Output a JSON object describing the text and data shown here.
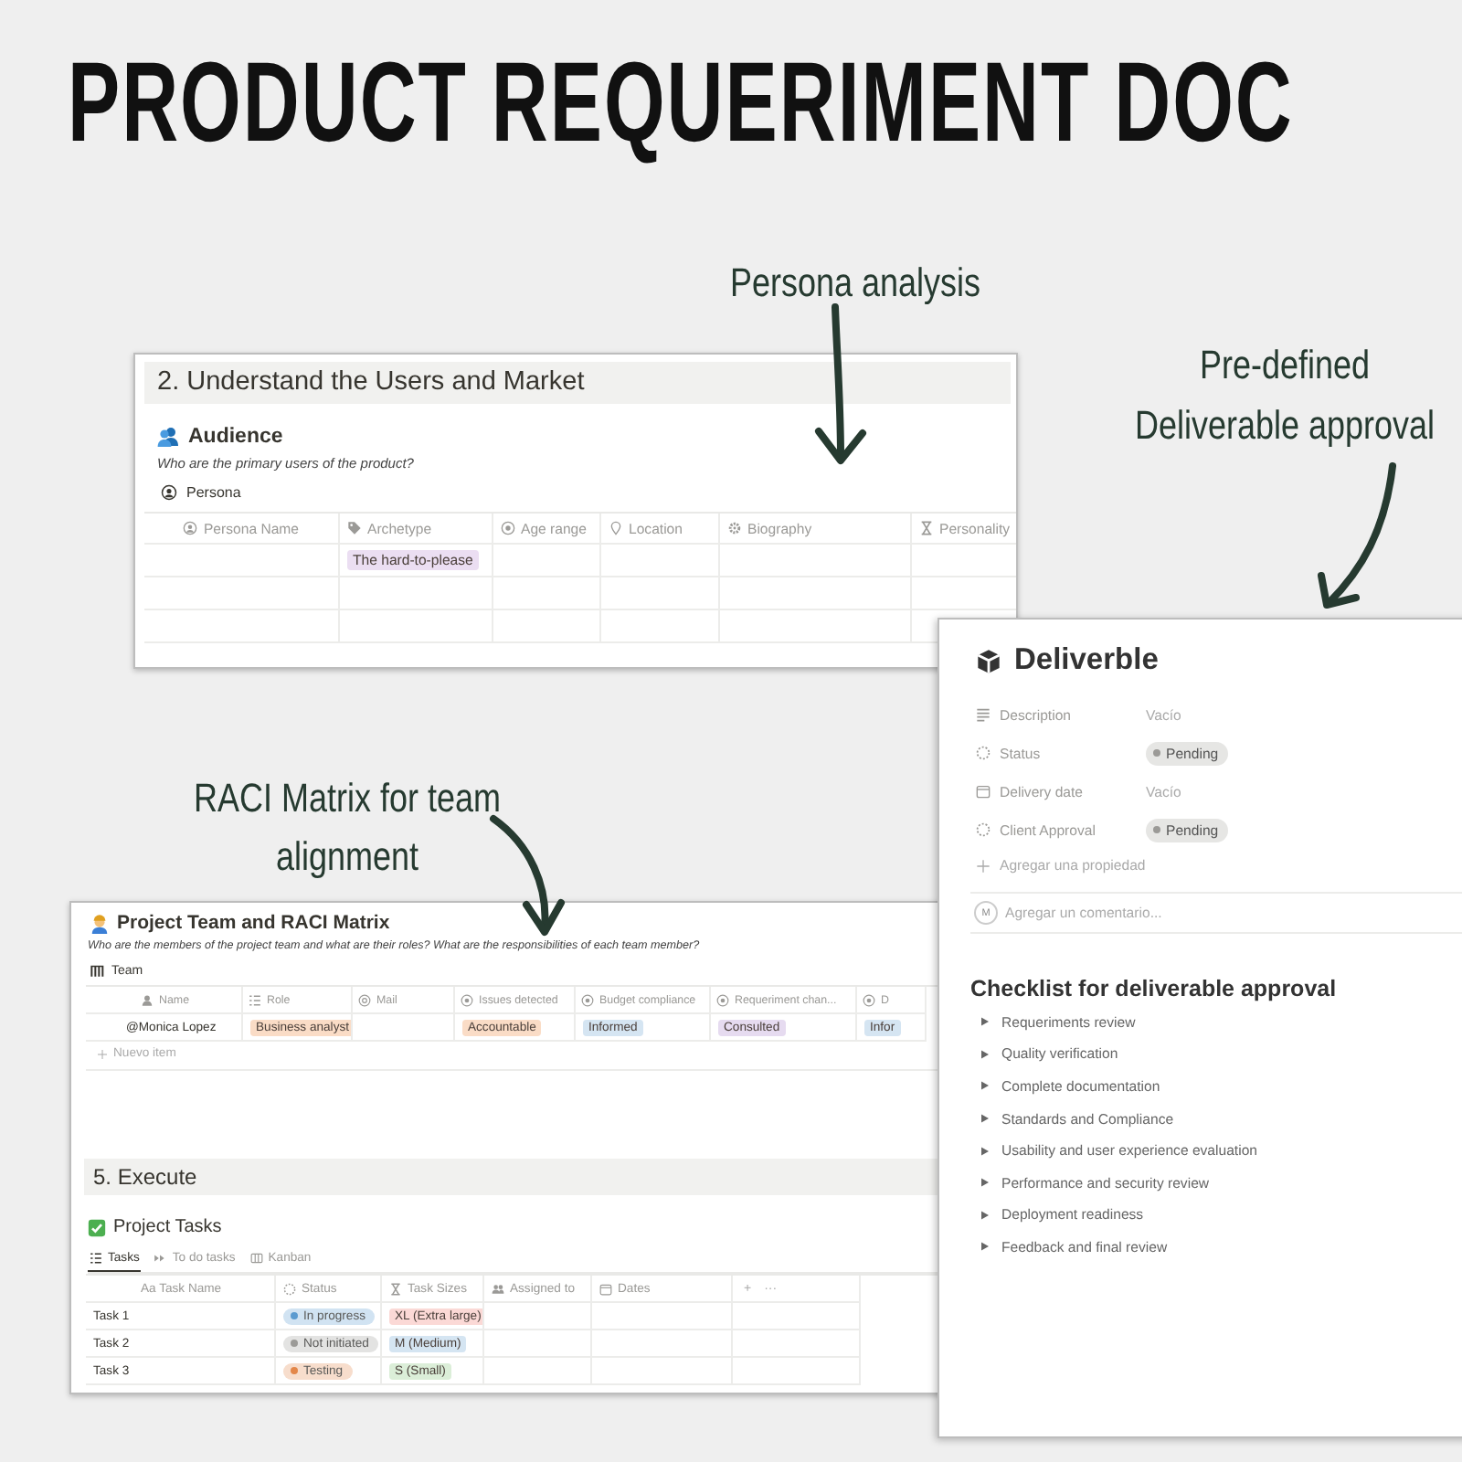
{
  "title": "PRODUCT REQUERIMENT DOC",
  "annotations": [
    {
      "text": "Persona analysis"
    },
    {
      "text": "Pre-defined\nDeliverable approval"
    },
    {
      "text": "RACI Matrix for team\nalignment"
    }
  ],
  "persona_panel": {
    "heading": "2. Understand the Users and Market",
    "section": "Audience",
    "question": "Who are the primary users of the product?",
    "database": "Persona",
    "columns": [
      "Persona Name",
      "Archetype",
      "Age range",
      "Location",
      "Biography",
      "Personality"
    ],
    "rows": [
      {
        "cells": [
          null,
          {
            "text": "The hard-to-please",
            "color": "#ebdef2"
          }
        ]
      },
      {
        "cells": []
      },
      {
        "cells": []
      }
    ]
  },
  "raci_panel": {
    "section": "Project Team and RACI Matrix",
    "question": "Who are the members of the project team and what are their roles? What are the responsibilities of each team member?",
    "database": "Team",
    "columns": [
      "Name",
      "Role",
      "Mail",
      "Issues detected",
      "Budget compliance",
      "Requeriment chan...",
      "D"
    ],
    "rows": [
      {
        "cells": [
          {
            "text": "@Monica Lopez"
          },
          {
            "text": "Business analyst",
            "color": "#fadcc6"
          },
          null,
          {
            "text": "Accountable",
            "color": "#fadcc6"
          },
          {
            "text": "Informed",
            "color": "#d5e5f2"
          },
          {
            "text": "Consulted",
            "color": "#e6dbf0"
          },
          {
            "text": "Infor",
            "color": "#d5e5f2"
          }
        ]
      }
    ],
    "add_row": "Nuevo item",
    "execute_heading": "5. Execute",
    "tasks_section": "Project Tasks",
    "tabs": [
      {
        "label": "Tasks",
        "selected": true
      },
      {
        "label": "To do tasks",
        "selected": false
      },
      {
        "label": "Kanban",
        "selected": false
      }
    ],
    "task_columns": [
      "Aa Task Name",
      "Status",
      "Task Sizes",
      "Assigned to",
      "Dates"
    ],
    "header_actions": [
      "+",
      "···"
    ],
    "task_rows": [
      {
        "cells": [
          {
            "text": "Task 1"
          },
          {
            "text": "In progress",
            "kind": "status",
            "color": "#5b9bd0"
          },
          {
            "text": "XL (Extra large)",
            "color": "#fbd9d6"
          }
        ]
      },
      {
        "cells": [
          {
            "text": "Task 2"
          },
          {
            "text": "Not initiated",
            "kind": "status",
            "color": "#9b9a97"
          },
          {
            "text": "M (Medium)",
            "color": "#d5e5f2"
          }
        ]
      },
      {
        "cells": [
          {
            "text": "Task 3"
          },
          {
            "text": "Testing",
            "kind": "status",
            "color": "#e3874a"
          },
          {
            "text": "S (Small)",
            "color": "#dbeed8"
          }
        ]
      }
    ]
  },
  "deliverable_panel": {
    "title": "Deliverble",
    "properties": [
      {
        "label": "Description",
        "kind": "text",
        "value": "Vacío"
      },
      {
        "label": "Status",
        "kind": "status",
        "value": "Pending",
        "color": "#9b9a97"
      },
      {
        "label": "Delivery date",
        "kind": "date",
        "value": "Vacío"
      },
      {
        "label": "Client Approval",
        "kind": "status",
        "value": "Pending",
        "color": "#9b9a97"
      }
    ],
    "add_property": "Agregar una propiedad",
    "comment_avatar": "M",
    "comment_placeholder": "Agregar un comentario...",
    "checklist_heading": "Checklist for deliverable approval",
    "checklist": [
      "Requeriments review",
      "Quality verification",
      "Complete documentation",
      "Standards and Compliance",
      "Usability and user experience evaluation",
      "Performance and security review",
      "Deployment readiness",
      "Feedback and final review"
    ]
  }
}
